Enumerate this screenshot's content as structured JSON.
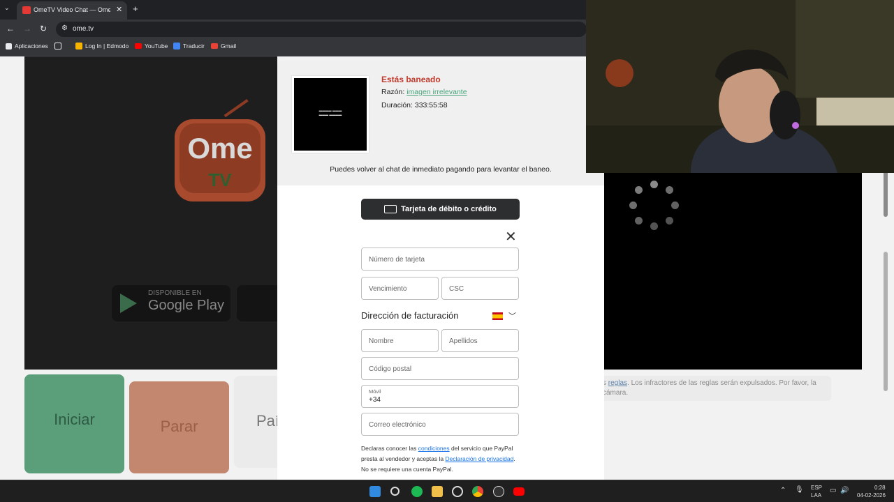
{
  "browser": {
    "tab_title": "OmeTV Video Chat — Omegle",
    "url": "ome.tv",
    "bookmarks": [
      {
        "label": "Aplicaciones",
        "color": "#e8eaed"
      },
      {
        "label": "",
        "color": "#e8eaed"
      },
      {
        "label": "Log In | Edmodo",
        "color": "#f4b400"
      },
      {
        "label": "YouTube",
        "color": "#ff0000"
      },
      {
        "label": "Traducir",
        "color": "#4285f4"
      },
      {
        "label": "Gmail",
        "color": "#ea4335"
      }
    ]
  },
  "page": {
    "logo_top": "Ome",
    "logo_bottom": "TV",
    "gplay_small": "DISPONIBLE EN",
    "gplay_big": "Google Play",
    "start_label": "Iniciar",
    "stop_label": "Parar",
    "country_label": "Paí",
    "rules_part1": "s ",
    "rules_link": "reglas",
    "rules_part2": ". Los infractores de las reglas serán expulsados. Por favor, la cámara."
  },
  "ban": {
    "title": "Estás baneado",
    "reason_label": "Razón: ",
    "reason_value": "imagen irrelevante",
    "duration": "Duración: 333:55:58",
    "info": "Puedes volver al chat de inmediato pagando para levantar el baneo."
  },
  "payment": {
    "button_label": "Tarjeta de débito o crédito",
    "card_number_placeholder": "Número de tarjeta",
    "expiry_placeholder": "Vencimiento",
    "csc_placeholder": "CSC",
    "billing_title": "Dirección de facturación",
    "first_name_placeholder": "Nombre",
    "last_name_placeholder": "Apellidos",
    "zip_placeholder": "Código postal",
    "phone_label": "Móvil",
    "phone_value": "+34",
    "email_placeholder": "Correo electrónico",
    "legal_1": "Declaras conocer las ",
    "legal_link1": "condiciones",
    "legal_2": " del servicio que PayPal presta al vendedor y aceptas la ",
    "legal_link2": "Declaración de privacidad",
    "legal_3": ". No se requiere una cuenta PayPal."
  },
  "taskbar": {
    "lang": "ESP",
    "layout": "LAA",
    "time": "0:28",
    "date": "04-02-2026"
  }
}
